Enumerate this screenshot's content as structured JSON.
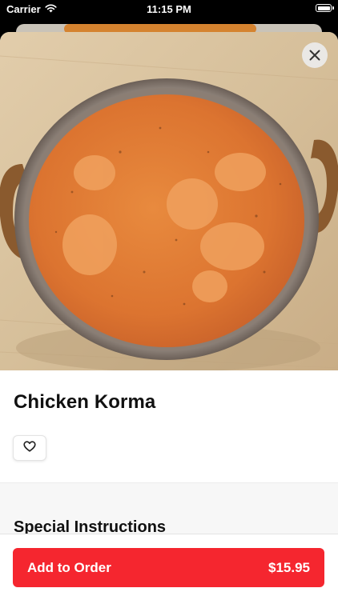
{
  "status_bar": {
    "carrier": "Carrier",
    "time": "11:15 PM",
    "battery_level": 1.0
  },
  "item": {
    "title": "Chicken Korma",
    "image_icon": "curry-bowl-photo"
  },
  "actions": {
    "close_icon": "close-icon",
    "favorite_icon": "heart-icon"
  },
  "special_instructions": {
    "heading": "Special Instructions"
  },
  "order": {
    "button_label": "Add to Order",
    "price": "$15.95"
  },
  "colors": {
    "accent": "#f5262f",
    "sauce": "#e0792f",
    "board": "#d9c3a1"
  }
}
